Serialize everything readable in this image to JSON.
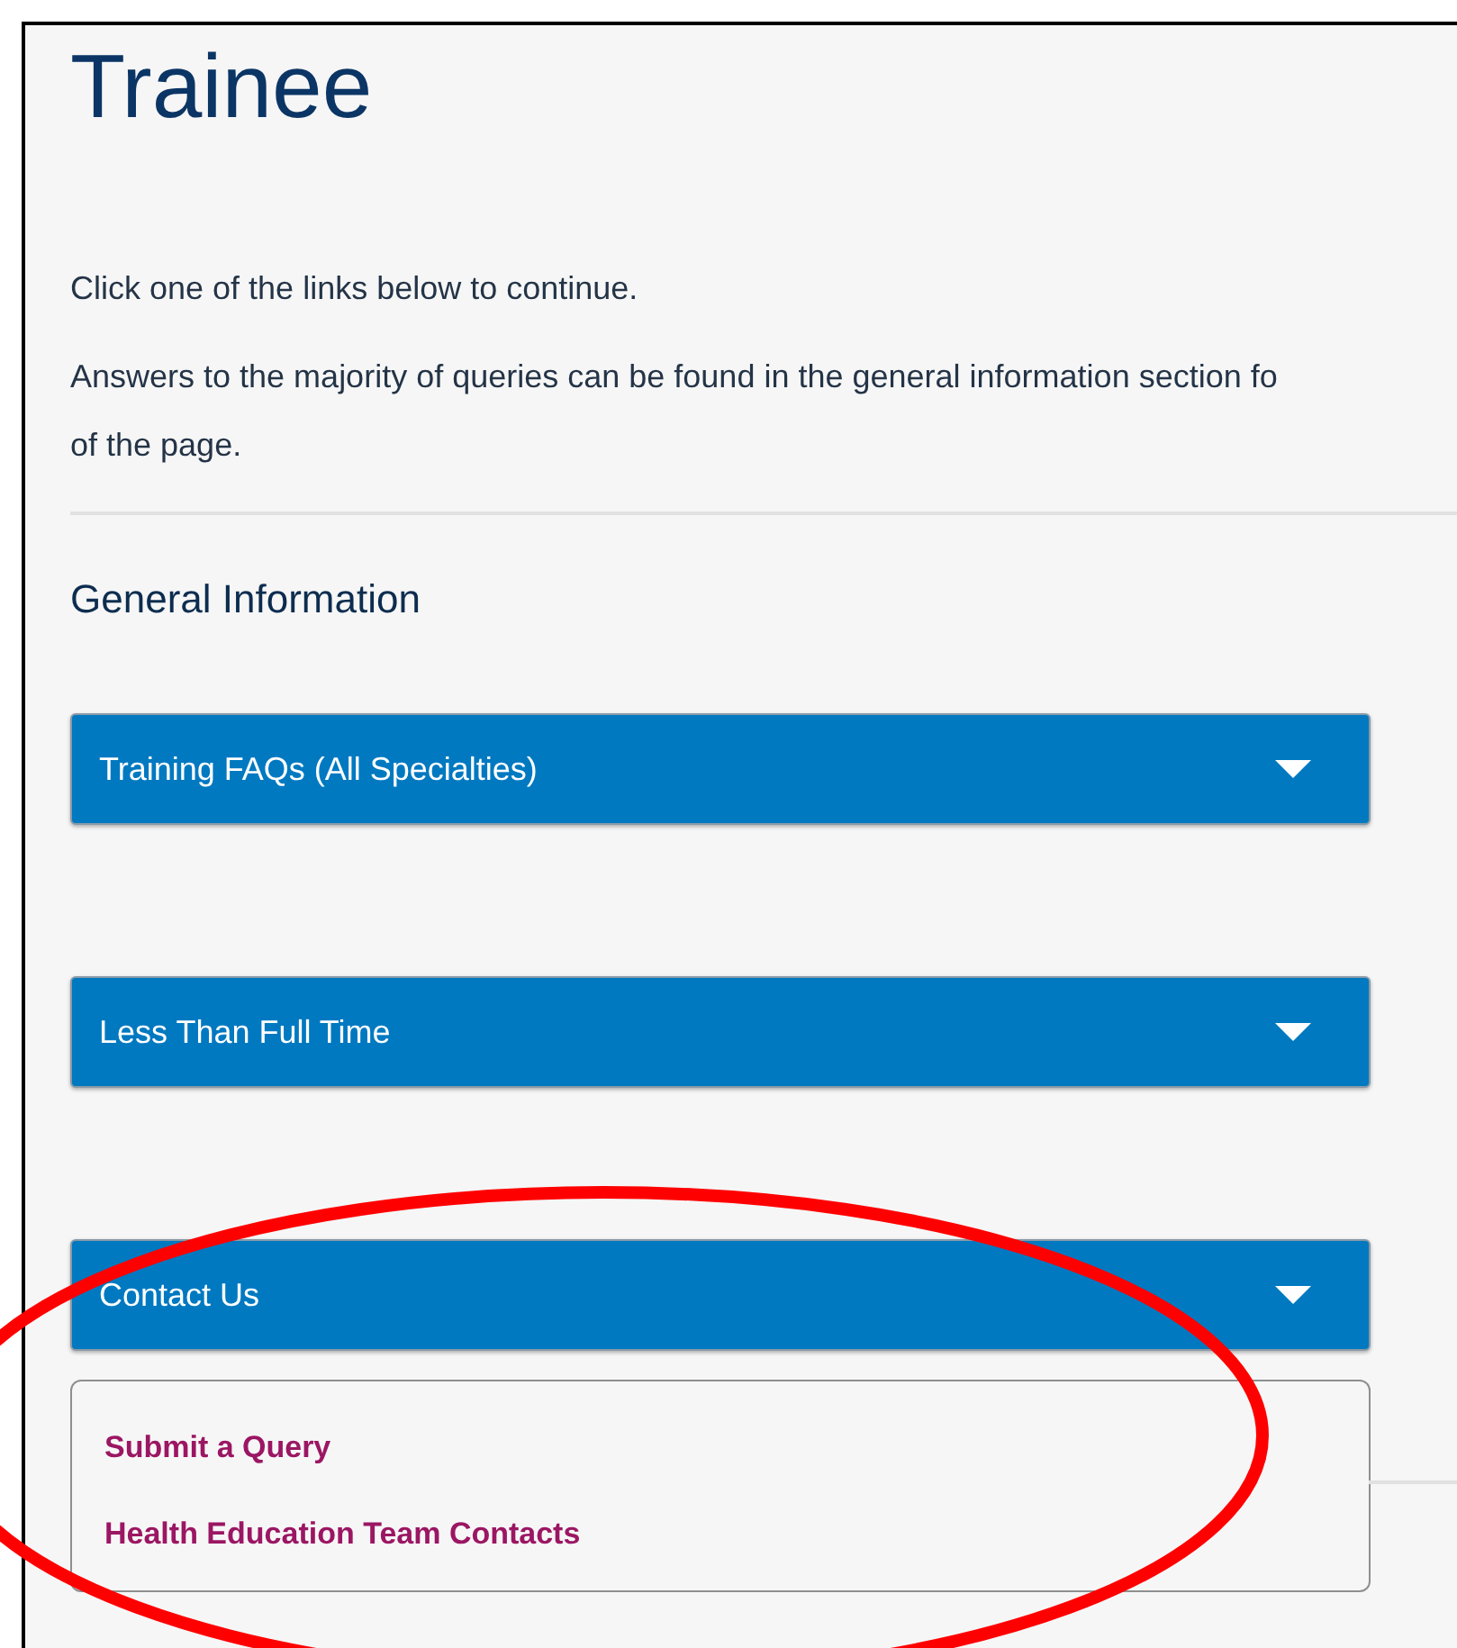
{
  "title": "Trainee",
  "intro": "Click one of the links below to continue.",
  "note_lines": [
    "Answers to the majority of queries can be found in the general information section fo",
    "of the page."
  ],
  "section_heading": "General Information",
  "accordions": [
    {
      "label": "Training FAQs (All Specialties)"
    },
    {
      "label": "Less Than Full Time"
    },
    {
      "label": "Contact Us",
      "links": [
        "Submit a Query",
        "Health Education Team Contacts"
      ]
    }
  ]
}
